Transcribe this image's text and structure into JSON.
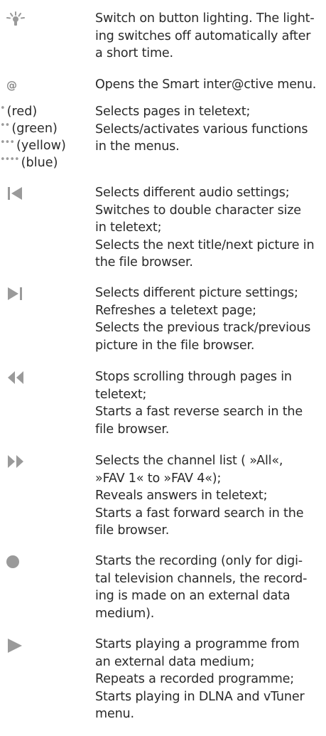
{
  "entries": [
    {
      "icon": "lighting-icon",
      "text": "Switch on button lighting. The light-\ning switches off automatically after\na short time."
    },
    {
      "icon": "at-icon",
      "symbol": "@",
      "text": "Opens the Smart inter@ctive menu."
    },
    {
      "icon": "color-buttons",
      "text": "Selects pages in teletext;\nSelects/activates various functions\nin the menus.",
      "color_buttons": [
        {
          "dots": "•",
          "label": "(red)"
        },
        {
          "dots": "••",
          "label": "(green)"
        },
        {
          "dots": "•••",
          "label": "(yellow)"
        },
        {
          "dots": "••••",
          "label": "(blue)"
        }
      ]
    },
    {
      "icon": "skip-back-icon",
      "text": "Selects different audio settings;\nSwitches to double character size\nin teletext;\nSelects the next title/next picture in\nthe file browser."
    },
    {
      "icon": "skip-forward-icon",
      "text": "Selects different picture settings;\nRefreshes a teletext page;\nSelects the previous track/previous\npicture in the file browser."
    },
    {
      "icon": "rewind-icon",
      "text": "Stops scrolling through pages in\nteletext;\nStarts a fast reverse search in the\nfile browser."
    },
    {
      "icon": "fast-forward-icon",
      "text": "Selects the channel list ( »All«,\n»FAV 1« to »FAV 4«);\nReveals answers in teletext;\nStarts a fast forward search in the\nfile browser."
    },
    {
      "icon": "record-icon",
      "text": "Starts the recording (only for digi-\ntal television channels, the record-\ning is made on an external data\nmedium)."
    },
    {
      "icon": "play-icon",
      "text": "Starts playing a programme from\nan external data medium;\nRepeats a recorded programme;\nStarts playing in DLNA and vTuner\nmenu."
    }
  ],
  "colors": {
    "icon": "#9a9a9a",
    "text": "#2a2a2a"
  }
}
